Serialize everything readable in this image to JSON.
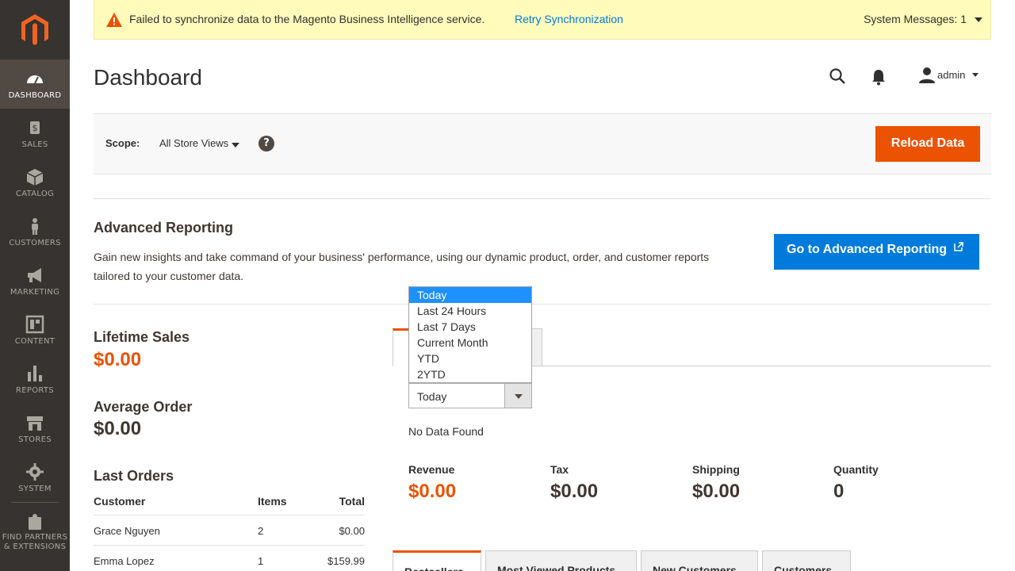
{
  "sidebar": {
    "items": [
      {
        "label": "Dashboard",
        "icon": "dashboard-icon"
      },
      {
        "label": "Sales",
        "icon": "dollar-icon"
      },
      {
        "label": "Catalog",
        "icon": "box-icon"
      },
      {
        "label": "Customers",
        "icon": "person-icon"
      },
      {
        "label": "Marketing",
        "icon": "megaphone-icon"
      },
      {
        "label": "Content",
        "icon": "layout-icon"
      },
      {
        "label": "Reports",
        "icon": "bar-chart-icon"
      },
      {
        "label": "Stores",
        "icon": "store-icon"
      },
      {
        "label": "System",
        "icon": "gear-icon"
      },
      {
        "label": "Find Partners & Extensions",
        "icon": "puzzle-icon"
      }
    ]
  },
  "message": {
    "text": "Failed to synchronize data to the Magento Business Intelligence service.",
    "retry_link": "Retry Synchronization",
    "system_messages": "System Messages: 1"
  },
  "header": {
    "title": "Dashboard",
    "username": "admin"
  },
  "scope": {
    "label": "Scope:",
    "value": "All Store Views",
    "help": "?",
    "reload_button": "Reload Data"
  },
  "advanced": {
    "title": "Advanced Reporting",
    "description": "Gain new insights and take command of your business' performance, using our dynamic product, order, and customer reports tailored to your customer data.",
    "button": "Go to Advanced Reporting"
  },
  "stats": {
    "lifetime_label": "Lifetime Sales",
    "lifetime_value": "$0.00",
    "average_label": "Average Order",
    "average_value": "$0.00"
  },
  "last_orders": {
    "title": "Last Orders",
    "columns": [
      "Customer",
      "Items",
      "Total"
    ],
    "rows": [
      {
        "customer": "Grace Nguyen",
        "items": "2",
        "total": "$0.00"
      },
      {
        "customer": "Emma Lopez",
        "items": "1",
        "total": "$159.99"
      }
    ]
  },
  "chart": {
    "period_options": [
      "Today",
      "Last 24 Hours",
      "Last 7 Days",
      "Current Month",
      "YTD",
      "2YTD"
    ],
    "period_selected": "Today",
    "no_data": "No Data Found"
  },
  "totals": {
    "revenue_label": "Revenue",
    "revenue_value": "$0.00",
    "tax_label": "Tax",
    "tax_value": "$0.00",
    "shipping_label": "Shipping",
    "shipping_value": "$0.00",
    "quantity_label": "Quantity",
    "quantity_value": "0"
  },
  "bottom_tabs": [
    "Bestsellers",
    "Most Viewed Products",
    "New Customers",
    "Customers"
  ],
  "colors": {
    "sidebar_bg": "#373330",
    "accent_orange": "#eb5202",
    "link_blue": "#007bdb",
    "message_bg": "#fffbbb"
  }
}
